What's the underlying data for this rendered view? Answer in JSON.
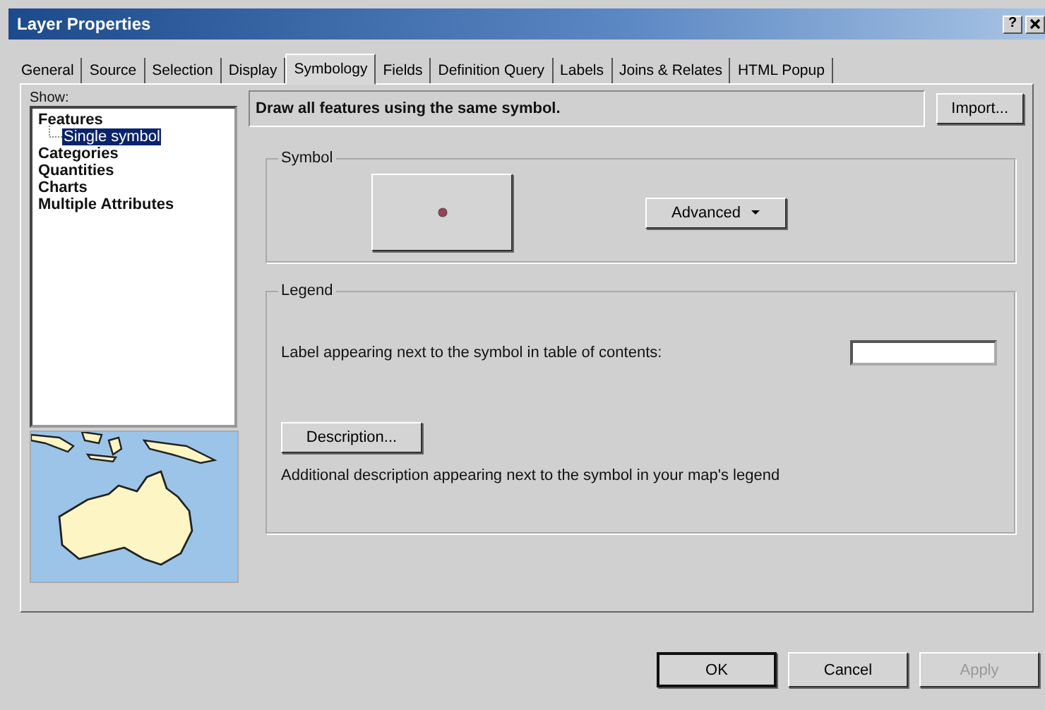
{
  "window": {
    "title": "Layer Properties",
    "help": "?"
  },
  "tabs": [
    {
      "label": "General",
      "selected": false
    },
    {
      "label": "Source",
      "selected": false
    },
    {
      "label": "Selection",
      "selected": false
    },
    {
      "label": "Display",
      "selected": false
    },
    {
      "label": "Symbology",
      "selected": true
    },
    {
      "label": "Fields",
      "selected": false
    },
    {
      "label": "Definition Query",
      "selected": false
    },
    {
      "label": "Labels",
      "selected": false
    },
    {
      "label": "Joins & Relates",
      "selected": false
    },
    {
      "label": "HTML Popup",
      "selected": false
    }
  ],
  "show": {
    "label": "Show:",
    "items": [
      {
        "label": "Features",
        "selected": false,
        "children": [
          {
            "label": "Single symbol",
            "selected": true
          }
        ]
      },
      {
        "label": "Categories",
        "selected": false
      },
      {
        "label": "Quantities",
        "selected": false
      },
      {
        "label": "Charts",
        "selected": false
      },
      {
        "label": "Multiple Attributes",
        "selected": false
      }
    ]
  },
  "header": {
    "text": "Draw all features using the same symbol.",
    "import_button": "Import..."
  },
  "symbol_group": {
    "title": "Symbol",
    "advanced_button": "Advanced"
  },
  "legend_group": {
    "title": "Legend",
    "label_text": "Label appearing next to the symbol in table of contents:",
    "description_button": "Description...",
    "description_text": "Additional description appearing next to the symbol in your map's legend"
  },
  "buttons": [
    {
      "label": "OK",
      "disabled": false,
      "default": true
    },
    {
      "label": "Cancel",
      "disabled": false,
      "default": false
    },
    {
      "label": "Apply",
      "disabled": true,
      "default": false
    }
  ]
}
